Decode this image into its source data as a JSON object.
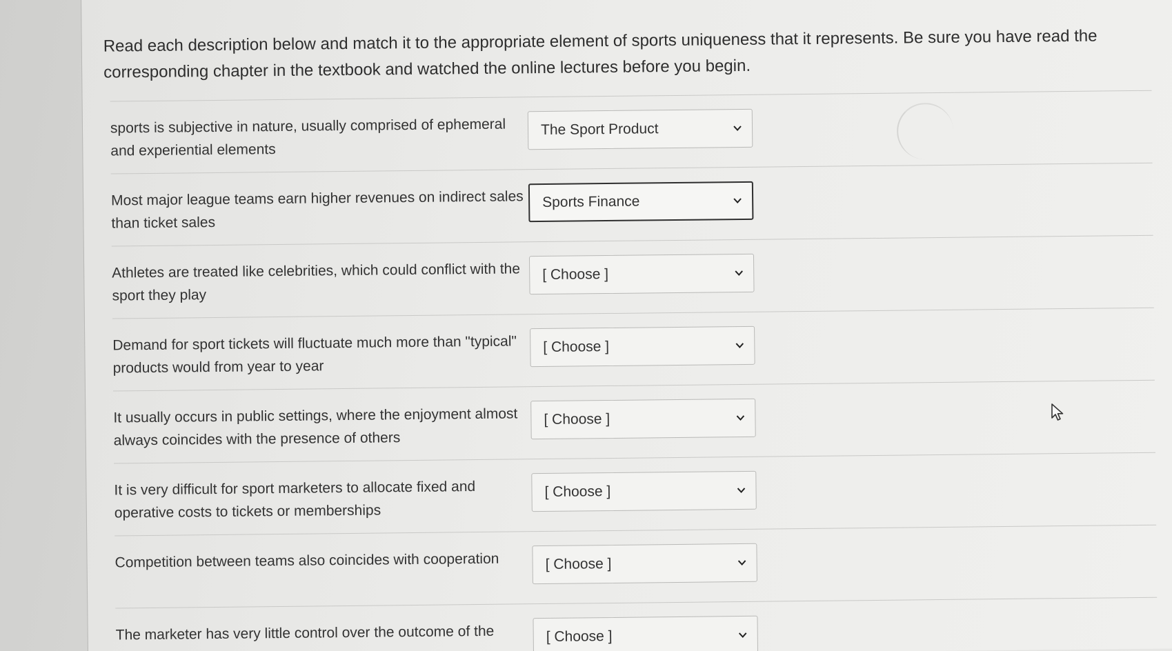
{
  "instructions": "Read each description below and match it to the appropriate element of sports uniqueness that it represents. Be sure you have read the corresponding chapter in the textbook and watched the online lectures before you begin.",
  "items": [
    {
      "description": "sports is subjective in nature, usually comprised of ephemeral and experiential elements",
      "selected": "The Sport Product"
    },
    {
      "description": "Most major league teams earn higher revenues on indirect sales than ticket sales",
      "selected": "Sports Finance"
    },
    {
      "description": "Athletes are treated like celebrities, which could conflict with the sport they play",
      "selected": "[ Choose ]"
    },
    {
      "description": "Demand for sport tickets will fluctuate much more than \"typical\" products would from year to year",
      "selected": "[ Choose ]"
    },
    {
      "description": "It usually occurs in public settings, where the enjoyment almost always coincides with the presence of others",
      "selected": "[ Choose ]"
    },
    {
      "description": "It is very difficult for sport marketers to allocate fixed and operative costs to tickets or memberships",
      "selected": "[ Choose ]"
    },
    {
      "description": "Competition between teams also coincides with cooperation",
      "selected": "[ Choose ]"
    },
    {
      "description": "The marketer has very little control over the outcome of the",
      "selected": "[ Choose ]"
    }
  ],
  "icons": {
    "dropdown": "chevron-down-icon",
    "cursor": "mouse-pointer-icon"
  }
}
